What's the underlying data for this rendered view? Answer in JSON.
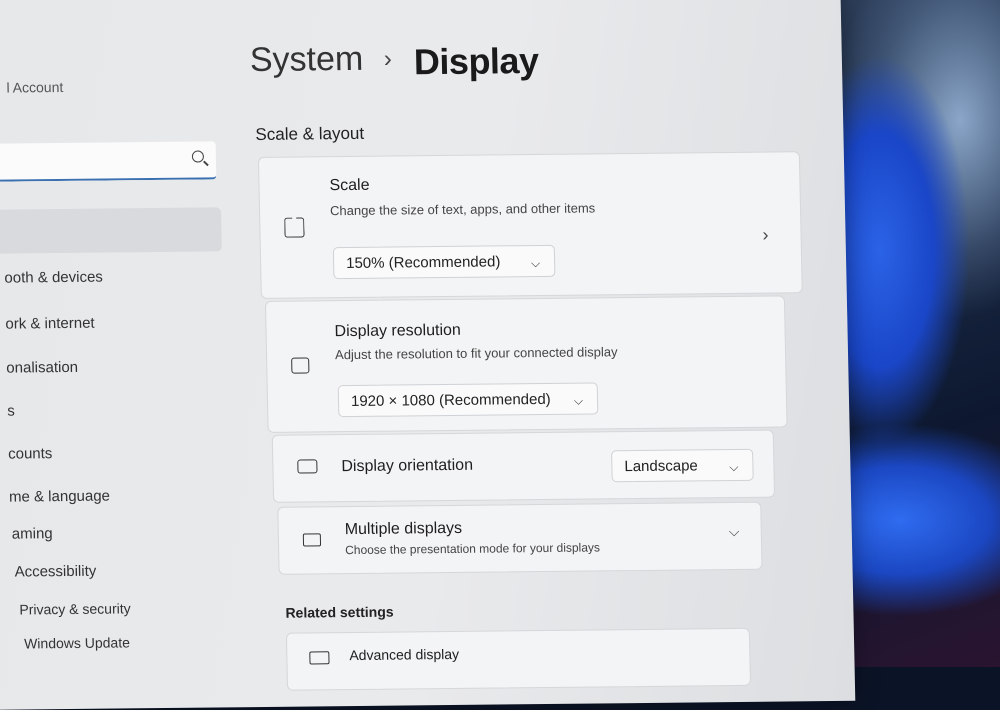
{
  "sidebar": {
    "account_label": "l Account",
    "search_placeholder": "",
    "items": [
      {
        "label": "ooth & devices"
      },
      {
        "label": "ork & internet"
      },
      {
        "label": "onalisation"
      },
      {
        "label": "s"
      },
      {
        "label": "counts"
      },
      {
        "label": "me & language"
      },
      {
        "label": "aming"
      },
      {
        "label": "Accessibility"
      },
      {
        "label": "Privacy & security"
      },
      {
        "label": "Windows Update"
      }
    ]
  },
  "breadcrumb": {
    "parent": "System",
    "separator": "›",
    "current": "Display"
  },
  "scale_layout": {
    "title": "Scale & layout",
    "scale": {
      "title": "Scale",
      "description": "Change the size of text, apps, and other items",
      "value": "150% (Recommended)"
    },
    "resolution": {
      "title": "Display resolution",
      "description": "Adjust the resolution to fit your connected display",
      "value": "1920 × 1080 (Recommended)"
    },
    "orientation": {
      "title": "Display orientation",
      "value": "Landscape"
    },
    "multiple": {
      "title": "Multiple displays",
      "description": "Choose the presentation mode for your displays"
    }
  },
  "related": {
    "title": "Related settings",
    "advanced_display": "Advanced display"
  },
  "icons": {
    "chevron_down": "⌵",
    "chevron_right": "›",
    "close": "✕"
  }
}
